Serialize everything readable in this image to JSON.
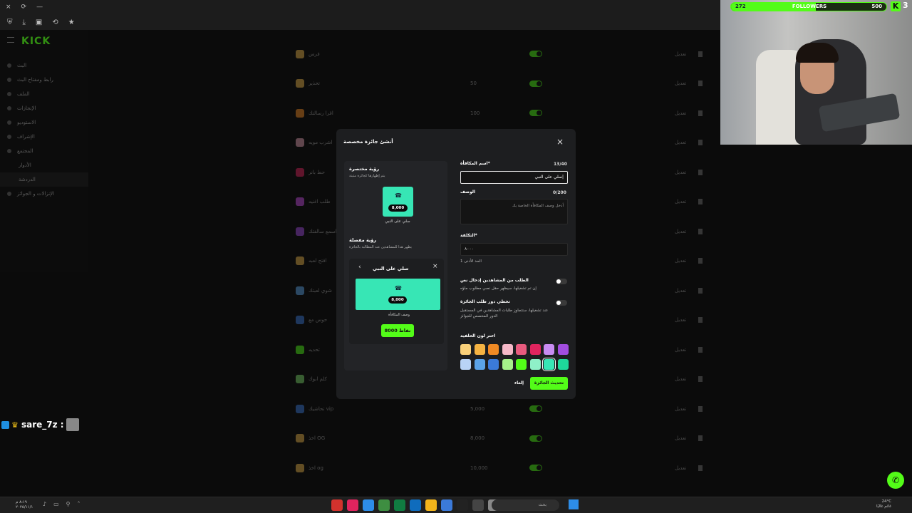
{
  "browser": {
    "close_glyph": "×",
    "reload_glyph": "⟳",
    "minimize_glyph": "—",
    "tool_glyphs": [
      "⛨",
      "⤓",
      "▣",
      "⟲",
      "★"
    ]
  },
  "sidebar": {
    "logo": "KICK",
    "items": [
      {
        "label": "البث"
      },
      {
        "label": "رابط ومفتاح البث"
      },
      {
        "label": "الملف"
      },
      {
        "label": "الإنجازات"
      },
      {
        "label": "الاستوديو"
      },
      {
        "label": "الإشراف"
      },
      {
        "label": "المجتمع"
      },
      {
        "label": "الأدوار",
        "sub": true
      },
      {
        "label": "الدردشة",
        "sub": true
      },
      {
        "label": "الإنزالات و الجوائز"
      }
    ]
  },
  "background_rows": [
    {
      "name": "فرس",
      "cost": "",
      "icon_color": "#e6b34a"
    },
    {
      "name": "تحذير",
      "cost": "50",
      "icon_color": "#e6b34a"
    },
    {
      "name": "اقرا رسالتك",
      "cost": "100",
      "icon_color": "#f08a24"
    },
    {
      "name": "اشرب مويه",
      "cost": "",
      "icon_color": "#e0a0b0"
    },
    {
      "name": "حط بانر",
      "cost": "",
      "icon_color": "#e0245e"
    },
    {
      "name": "طلب اغنيه",
      "cost": "",
      "icon_color": "#c44ddf"
    },
    {
      "name": "اسمع سالفتك",
      "cost": "",
      "icon_color": "#a24ddf"
    },
    {
      "name": "افتح لعبه",
      "cost": "",
      "icon_color": "#e6b34a"
    },
    {
      "name": "شوي لعبتك",
      "cost": "",
      "icon_color": "#5ba3e8"
    },
    {
      "name": "حوس مع",
      "cost": "",
      "icon_color": "#3b7ad9"
    },
    {
      "name": "تحديه",
      "cost": "",
      "icon_color": "#53fc18"
    },
    {
      "name": "كلم ابوك",
      "cost": "",
      "icon_color": "#7bd96a"
    },
    {
      "name": "تحاشيك vip",
      "cost": "5,000",
      "icon_color": "#3b7ad9"
    },
    {
      "name": "اخذ OG",
      "cost": "8,000",
      "icon_color": "#e6b34a"
    },
    {
      "name": "اخذ og",
      "cost": "10,000",
      "icon_color": "#e6b34a"
    }
  ],
  "background_edit_label": "تعديل",
  "modal": {
    "title": "أنشئ جائزة مخصصة",
    "close_glyph": "×",
    "preview": {
      "compact_title": "رؤية مختصرة",
      "compact_sub": "يتم إظهارها كجائزة مثبتة",
      "compact_cost": "8,000",
      "compact_name": "سلي على النبي",
      "detail_title": "رؤية مفصلة",
      "detail_sub": "يظهر هذا للمشاهدين عند المطالبة بالجائزة",
      "detail_name": "سلي على النبي",
      "detail_cost": "8,000",
      "detail_desc": "وصف المكافأة",
      "detail_button": "8000 نقاط",
      "gift_glyph": "☎",
      "back_glyph": "‹",
      "close_glyph": "×"
    },
    "form": {
      "name_label": "اسم المكافأة*",
      "name_count": "13/40",
      "name_value": "سلي على النبي|",
      "desc_label": "الوصف",
      "desc_count": "0/200",
      "desc_placeholder": "أدخل وصف المكافأة الخاصة بك",
      "cost_label": "التكلفة*",
      "cost_value": "٨٠٠٠",
      "cost_hint": "الحد الأدنى 1",
      "toggle1_label": "الطلب من المشاهدين إدخال نص",
      "toggle1_hint": "إن تم تشغيلها، سيظهر حقل نصي مطلوب ملؤه",
      "toggle2_label": "تخطي دور طلب الجائزة",
      "toggle2_hint": "عند تشغيلها، ستتجاوز طلبات المشاهدين في المستقبل الدور المخصص للجوائز",
      "color_label": "اختر لون الخلفية",
      "colors": [
        "#f9d07a",
        "#f5b342",
        "#f08a24",
        "#f5b8c8",
        "#e85b7e",
        "#e0245e",
        "#c98cf2",
        "#a24ddf",
        "#b9d3f5",
        "#5ba3e8",
        "#3b7ad9",
        "#a6f08a",
        "#53fc18",
        "#8ff0c8",
        "#37e6b5",
        "#1ed99b"
      ],
      "selected_color_index": 14,
      "update_button": "تحديث الجائزة",
      "cancel_button": "إلغاء"
    }
  },
  "stream_overlay": {
    "followers_current": "272",
    "followers_label": "FOLLOWERS",
    "followers_goal": "500",
    "followers_progress": 0.544,
    "kick_badge": "K",
    "kick_count": "3",
    "chat_user": "sare_7z :",
    "help_glyph": "✆"
  },
  "taskbar": {
    "clock_line1": "٨:١٩ م",
    "clock_line2": "٢٠٢٥/١١/١",
    "search_placeholder": "بحث",
    "weather_line1": "24°C",
    "weather_line2": "غائم غالبًا",
    "app_colors": [
      "#d2322d",
      "#e0245e",
      "#2d8de8",
      "#3e8e41",
      "#107c41",
      "#0f6cbd",
      "#f3b51b",
      "#3b7ad9",
      "#222222",
      "#444444",
      "#888888"
    ]
  }
}
